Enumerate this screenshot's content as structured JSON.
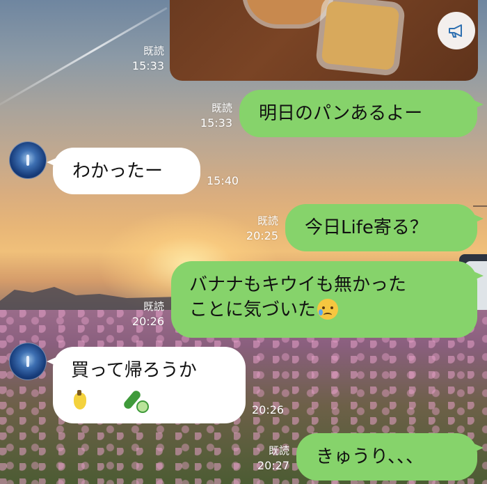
{
  "messages": [
    {
      "id": "m1",
      "side": "me",
      "type": "image",
      "read": "既読",
      "time": "15:33"
    },
    {
      "id": "m2",
      "side": "me",
      "text": "明日のパンあるよー",
      "read": "既読",
      "time": "15:33"
    },
    {
      "id": "m3",
      "side": "them",
      "text": "わかったー",
      "time": "15:40"
    },
    {
      "id": "m4",
      "side": "me",
      "text": "今日Life寄る？",
      "read": "既読",
      "time": "20:25"
    },
    {
      "id": "m5",
      "side": "me",
      "lines": [
        "バナナもキウイも無かった",
        "ことに気づいた"
      ],
      "emoji": "crying-face",
      "read": "既読",
      "time": "20:26"
    },
    {
      "id": "m6",
      "side": "them",
      "text": "買って帰ろうか",
      "emojis": [
        "banana",
        "cucumber"
      ],
      "time": "20:26"
    },
    {
      "id": "m7",
      "side": "me",
      "text": "きゅうり、、、",
      "read": "既読",
      "time": "20:27"
    }
  ],
  "colors": {
    "my_bubble": "#86d36b",
    "their_bubble": "#ffffff"
  },
  "icons": {
    "image_action": "megaphone-icon"
  }
}
